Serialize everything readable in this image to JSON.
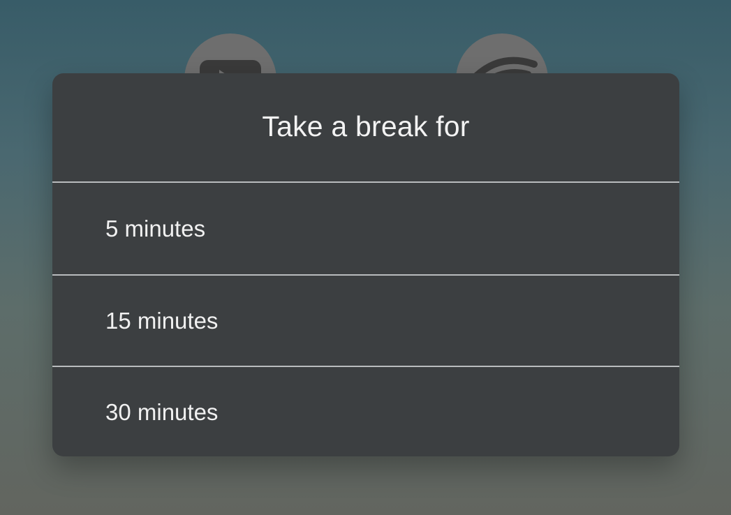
{
  "dialog": {
    "title": "Take a break for",
    "options": [
      {
        "label": "5 minutes"
      },
      {
        "label": "15 minutes"
      },
      {
        "label": "30 minutes"
      }
    ]
  },
  "background_icons": [
    "app-icon",
    "app-icon"
  ],
  "colors": {
    "dialog_background": "#3c3f41",
    "divider": "#b9bcbe",
    "text": "#f3f3f3"
  }
}
